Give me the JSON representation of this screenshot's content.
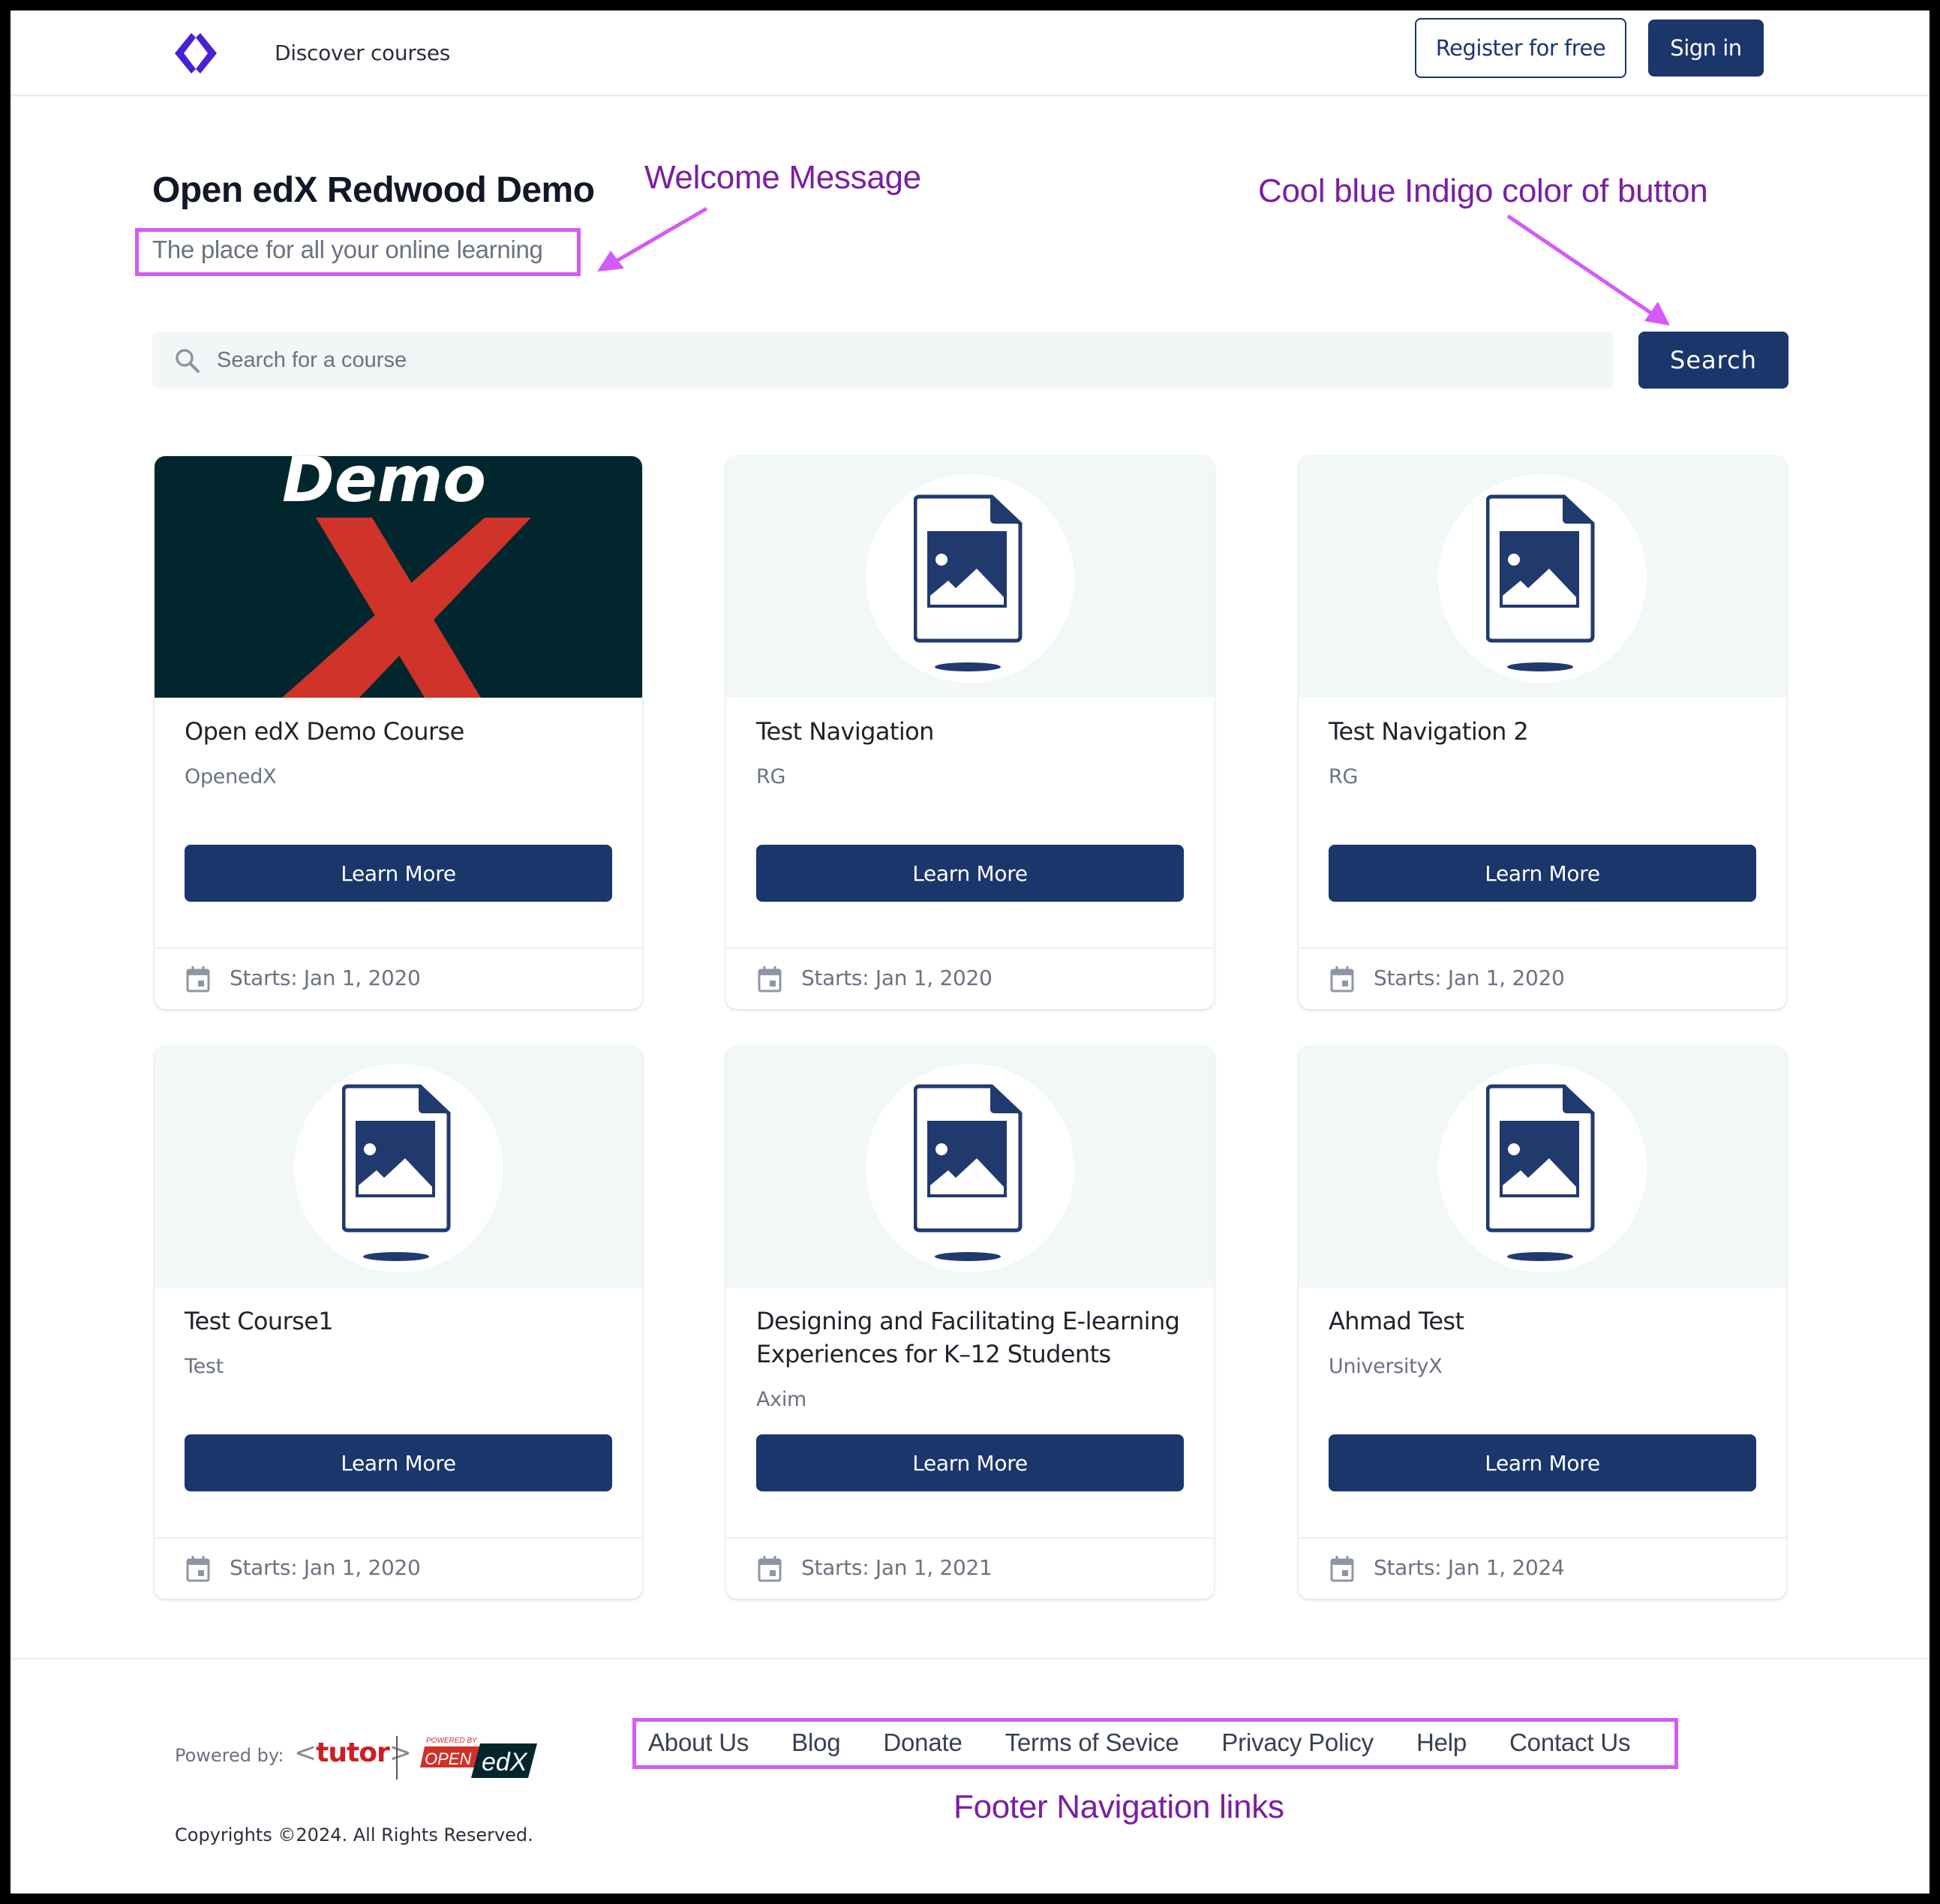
{
  "header": {
    "logo_icon": "code-brackets-icon",
    "nav_link": "Discover courses",
    "register_label": "Register for free",
    "signin_label": "Sign in"
  },
  "hero": {
    "title": "Open edX Redwood Demo",
    "subtitle": "The place for all your online learning"
  },
  "search": {
    "placeholder": "Search for a course",
    "value": "",
    "button_label": "Search",
    "icon": "search-icon"
  },
  "courses": [
    {
      "title": "Open edX Demo Course",
      "org": "OpenedX",
      "button": "Learn More",
      "date": "Starts: Jan 1, 2020",
      "image": "demo-x-banner",
      "image_text": "Demo"
    },
    {
      "title": "Test Navigation",
      "org": "RG",
      "button": "Learn More",
      "date": "Starts: Jan 1, 2020",
      "image": "placeholder-image-icon"
    },
    {
      "title": "Test Navigation 2",
      "org": "RG",
      "button": "Learn More",
      "date": "Starts: Jan 1, 2020",
      "image": "placeholder-image-icon"
    },
    {
      "title": "Test Course1",
      "org": "Test",
      "button": "Learn More",
      "date": "Starts: Jan 1, 2020",
      "image": "placeholder-image-icon"
    },
    {
      "title": "Designing and Facilitating E-learning Experiences for K–12 Students",
      "org": "Axim",
      "button": "Learn More",
      "date": "Starts: Jan 1, 2021",
      "image": "placeholder-image-icon"
    },
    {
      "title": "Ahmad Test",
      "org": "UniversityX",
      "button": "Learn More",
      "date": "Starts: Jan 1, 2024",
      "image": "placeholder-image-icon"
    }
  ],
  "footer": {
    "powered_by_label": "Powered by:",
    "tutor_logo_text": "tutor",
    "openedx_logo": {
      "top": "POWERED BY",
      "open": "OPEN",
      "edx": "edX"
    },
    "links": [
      "About Us",
      "Blog",
      "Donate",
      "Terms of Sevice",
      "Privacy Policy",
      "Help",
      "Contact Us"
    ],
    "copyright": "Copyrights ©2024. All Rights Reserved."
  },
  "annotations": {
    "welcome": "Welcome Message",
    "button_color": "Cool blue Indigo color of button",
    "footer_nav": "Footer Navigation links"
  },
  "colors": {
    "primary": "#1a366b",
    "logo": "#4a1fd6",
    "annotation_box": "#d45bf7",
    "annotation_text": "#7a1fa2",
    "search_bg": "#f2f6f6"
  }
}
